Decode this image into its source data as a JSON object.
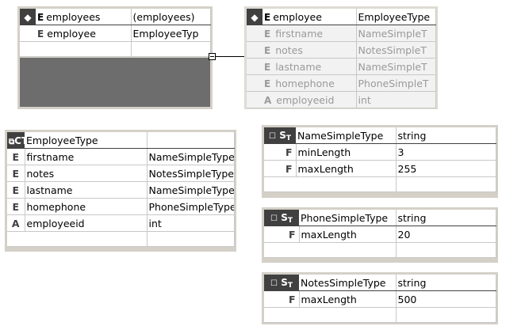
{
  "employees_element": {
    "kind": "E",
    "name": "employees",
    "type": "(employees)",
    "children": [
      {
        "kind": "E",
        "name": "employee",
        "type": "EmployeeTyp"
      }
    ]
  },
  "employee_element": {
    "kind": "E",
    "name": "employee",
    "type": "EmployeeType",
    "children": [
      {
        "kind": "E",
        "name": "firstname",
        "type": "NameSimpleT"
      },
      {
        "kind": "E",
        "name": "notes",
        "type": "NotesSimpleT"
      },
      {
        "kind": "E",
        "name": "lastname",
        "type": "NameSimpleT"
      },
      {
        "kind": "E",
        "name": "homephone",
        "type": "PhoneSimpleT"
      },
      {
        "kind": "A",
        "name": "employeeid",
        "type": "int"
      }
    ]
  },
  "employee_type": {
    "icon": "CT",
    "name": "EmployeeType",
    "type": "",
    "children": [
      {
        "kind": "E",
        "name": "firstname",
        "type": "NameSimpleType"
      },
      {
        "kind": "E",
        "name": "notes",
        "type": "NotesSimpleType"
      },
      {
        "kind": "E",
        "name": "lastname",
        "type": "NameSimpleType"
      },
      {
        "kind": "E",
        "name": "homephone",
        "type": "PhoneSimpleType"
      },
      {
        "kind": "A",
        "name": "employeeid",
        "type": "int"
      }
    ]
  },
  "name_simple_type": {
    "icon": "ST",
    "name": "NameSimpleType",
    "base": "string",
    "facets": [
      {
        "kind": "F",
        "name": "minLength",
        "value": "3"
      },
      {
        "kind": "F",
        "name": "maxLength",
        "value": "255"
      }
    ]
  },
  "phone_simple_type": {
    "icon": "ST",
    "name": "PhoneSimpleType",
    "base": "string",
    "facets": [
      {
        "kind": "F",
        "name": "maxLength",
        "value": "20"
      }
    ]
  },
  "notes_simple_type": {
    "icon": "ST",
    "name": "NotesSimpleType",
    "base": "string",
    "facets": [
      {
        "kind": "F",
        "name": "maxLength",
        "value": "500"
      }
    ]
  }
}
